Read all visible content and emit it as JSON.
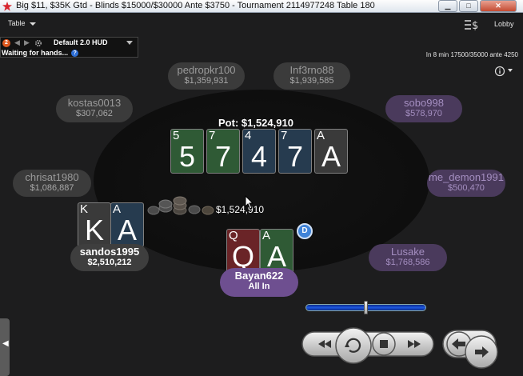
{
  "window": {
    "title": "Big $11, $35K Gtd - Blinds $15000/$30000 Ante $3750 - Tournament 2114977248 Table 180",
    "minimize_label": "▁",
    "maximize_label": "□",
    "close_label": "✕"
  },
  "menubar": {
    "table_label": "Table",
    "lobby_label": "Lobby"
  },
  "hud": {
    "badge": "2",
    "nav_prev": "◀",
    "nav_next": "▶",
    "name": "Default 2.0 HUD",
    "status": "Waiting for hands...",
    "help": "?"
  },
  "blind_info": "In 8 min 17500/35000 ante 4250",
  "pot": {
    "label": "Pot: $1,524,910",
    "chip_amount": "$1,524,910"
  },
  "board_cards": [
    {
      "rank": "5",
      "suit": "club"
    },
    {
      "rank": "7",
      "suit": "club"
    },
    {
      "rank": "4",
      "suit": "diamond"
    },
    {
      "rank": "7",
      "suit": "diamond"
    },
    {
      "rank": "A",
      "suit": "spade"
    }
  ],
  "hole_cards": {
    "sandos": [
      {
        "rank": "K",
        "suit": "spade"
      },
      {
        "rank": "A",
        "suit": "diamond"
      }
    ],
    "bayan": [
      {
        "rank": "Q",
        "suit": "heart"
      },
      {
        "rank": "A",
        "suit": "club"
      }
    ]
  },
  "dealer_button": "D",
  "seats": {
    "pedropkr100": {
      "name": "pedropkr100",
      "stack": "$1,359,931"
    },
    "inf3rno88": {
      "name": "Inf3rno88",
      "stack": "$1,939,585"
    },
    "kostas0013": {
      "name": "kostas0013",
      "stack": "$307,062"
    },
    "sobo998": {
      "name": "sobo998",
      "stack": "$578,970"
    },
    "chrisat1980": {
      "name": "chrisat1980",
      "stack": "$1,086,887"
    },
    "me_demon1991": {
      "name": "me_demon1991",
      "stack": "$500,470"
    },
    "sandos1995": {
      "name": "sandos1995",
      "stack": "$2,510,212"
    },
    "lusake": {
      "name": "Lusake",
      "stack": "$1,768,586"
    },
    "bayan622": {
      "name": "Bayan622",
      "stack": "All In"
    }
  },
  "bet_slider": {
    "position_fraction": 0.5
  },
  "colors": {
    "club_card": "#2f5a35",
    "diamond_card": "#263b4f",
    "spade_card": "#3a3a3a",
    "heart_card": "#6a2427",
    "noted_player": "#4a3a5c",
    "hero_plate": "#6e4f90",
    "dealer_button": "#3f83d8"
  },
  "icons": {
    "cashier": "dollar-lines-icon",
    "info": "info-icon",
    "replay_rewind": "rewind-icon",
    "replay_restart": "replay-icon",
    "replay_stop": "stop-icon",
    "replay_forward": "fast-forward-icon",
    "prev_hand": "arrow-left-icon",
    "next_hand": "arrow-right-icon"
  }
}
